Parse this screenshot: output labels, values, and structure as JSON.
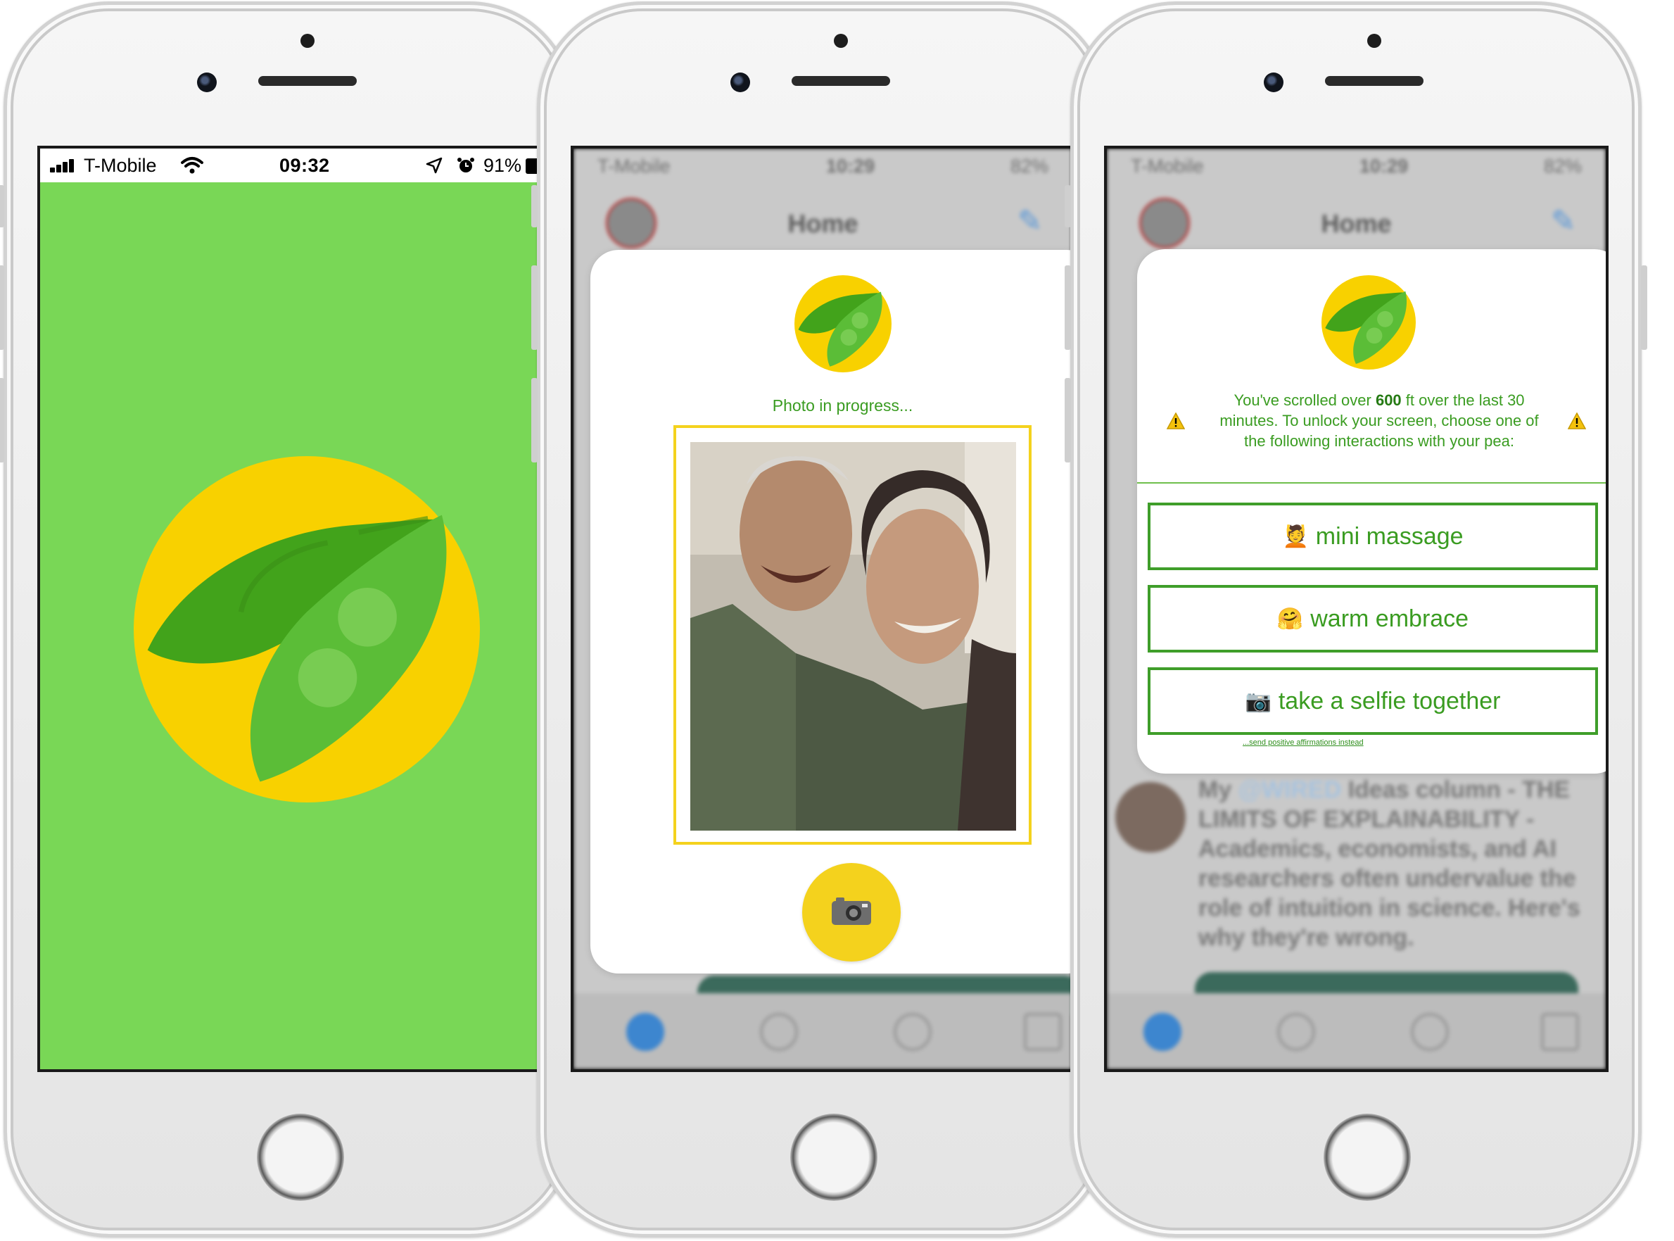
{
  "screen1": {
    "status_bar": {
      "carrier": "T-Mobile",
      "time": "09:32",
      "battery": "91%"
    },
    "colors": {
      "background": "#79d756",
      "logo_circle": "#f8d100",
      "pod_dark": "#42a31b",
      "pod_light": "#5bbd37"
    }
  },
  "screen2": {
    "background_status": {
      "carrier": "T-Mobile",
      "time": "10:29",
      "battery": "82%"
    },
    "background_title": "Home",
    "modal": {
      "status_text": "Photo in progress...",
      "shutter_icon": "camera-icon"
    },
    "colors": {
      "accent": "#f4d21d",
      "text": "#3a9c21"
    }
  },
  "screen3": {
    "background_status": {
      "carrier": "T-Mobile",
      "time": "10:29",
      "battery": "82%"
    },
    "background_title": "Home",
    "background_tweet": {
      "mention": "@WIRED",
      "before": "My ",
      "after": " Ideas column - THE LIMITS OF EXPLAINABILITY - Academics, economists, and AI researchers often undervalue the role of intuition in science. Here's why they're wrong."
    },
    "modal": {
      "message_before": "You've scrolled over ",
      "message_distance": "600",
      "message_after": " ft over the last 30 minutes. To unlock your screen, choose one of the following interactions with your pea:",
      "options": [
        {
          "emoji": "💆",
          "label": "mini massage"
        },
        {
          "emoji": "🤗",
          "label": "warm embrace"
        },
        {
          "emoji": "📷",
          "label": "take a selfie together"
        }
      ],
      "link_text": "...send positive affirmations instead"
    },
    "colors": {
      "accent": "#3a9c21",
      "button_border": "#3f9e2a",
      "warning": "#f4c20d"
    }
  }
}
